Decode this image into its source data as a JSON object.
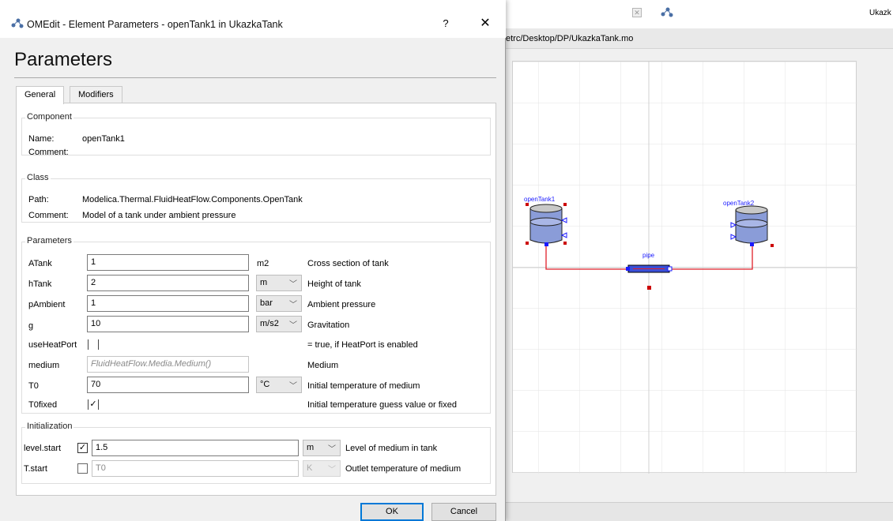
{
  "background_window": {
    "title_right": "Ukazk",
    "file_path": "etrc/Desktop/DP/UkazkaTank.mo",
    "diagram": {
      "tank1_label": "openTank1",
      "tank2_label": "openTank2",
      "pipe_label": "pipe"
    },
    "colors": {
      "connection": "#e0202a",
      "selection_handle": "#cc0000",
      "port": "#1a1aff",
      "tank_fill": "#8a9cd8",
      "pipe_fill": "#3b4fd6"
    }
  },
  "dialog": {
    "title": "OMEdit - Element Parameters - openTank1 in UkazkaTank",
    "help_label": "?",
    "close_label": "✕",
    "heading": "Parameters",
    "tabs": [
      {
        "label": "General",
        "active": true
      },
      {
        "label": "Modifiers",
        "active": false
      }
    ],
    "component": {
      "group_title": "Component",
      "name_label": "Name:",
      "name_value": "openTank1",
      "comment_label": "Comment:",
      "comment_value": ""
    },
    "class": {
      "group_title": "Class",
      "path_label": "Path:",
      "path_value": "Modelica.Thermal.FluidHeatFlow.Components.OpenTank",
      "comment_label": "Comment:",
      "comment_value": "Model of a tank under ambient pressure"
    },
    "parameters": {
      "group_title": "Parameters",
      "rows": [
        {
          "name": "ATank",
          "value": "1",
          "unit": "m2",
          "description": "Cross section of tank"
        },
        {
          "name": "hTank",
          "value": "2",
          "unit": "m",
          "description": "Height of tank"
        },
        {
          "name": "pAmbient",
          "value": "1",
          "unit": "bar",
          "description": "Ambient pressure"
        },
        {
          "name": "g",
          "value": "10",
          "unit": "m/s2",
          "description": "Gravitation"
        },
        {
          "name": "useHeatPort",
          "value": "",
          "unit": "",
          "description": "= true, if HeatPort is enabled"
        },
        {
          "name": "medium",
          "value": "FluidHeatFlow.Media.Medium()",
          "unit": "",
          "description": "Medium"
        },
        {
          "name": "T0",
          "value": "70",
          "unit": "°C",
          "description": "Initial temperature of medium"
        },
        {
          "name": "T0fixed",
          "value": "✓",
          "unit": "",
          "description": "Initial temperature guess value or fixed"
        }
      ]
    },
    "initialization": {
      "group_title": "Initialization",
      "rows": [
        {
          "name": "level.start",
          "checked": true,
          "check_mark": "✓",
          "value": "1.5",
          "unit": "m",
          "description": "Level of medium in tank"
        },
        {
          "name": "T.start",
          "checked": false,
          "check_mark": "",
          "value": "T0",
          "unit": "K",
          "description": "Outlet temperature of medium"
        }
      ]
    },
    "buttons": {
      "ok": "OK",
      "cancel": "Cancel"
    },
    "icons": {
      "app_logo": "omedit-logo-icon",
      "dropdown": "chevron-down-icon"
    }
  }
}
